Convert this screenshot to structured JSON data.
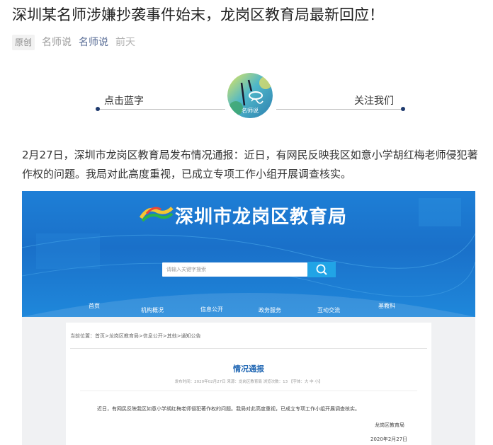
{
  "article": {
    "title": "深圳某名师涉嫌抄袭事件始末，龙岗区教育局最新回应！",
    "badge": "原创",
    "author": "名师说",
    "account": "名师说",
    "time": "前天"
  },
  "follow": {
    "left_label": "点击蓝字",
    "right_label": "关注我们",
    "logo_text": "名师说"
  },
  "body": {
    "paragraph": "2月27日，深圳市龙岗区教育局发布情况通报：近日，有网民反映我区如意小学胡红梅老师侵犯著作权的问题。我局对此高度重视，已成立专项工作小组开展调查核实。"
  },
  "embedded": {
    "site_name": "深圳市龙岗区教育局",
    "search_placeholder": "请输入关键字搜索",
    "nav": [
      "首页",
      "机构概况",
      "信息公开",
      "政务服务",
      "互动交流",
      "基教科"
    ],
    "breadcrumb": "当前位置：首页>龙岗区教育局>信息公开>其他>通知公告",
    "doc_title": "情况通报",
    "doc_meta": "发布时间：2020年02月27日    来源：龙岗区教育局    浏览次数：13    【字体：大 中 小】",
    "doc_body": "近日，有网民反映我区如意小学胡红梅老师侵犯著作权的问题。我局对此高度重视，已成立专项工作小组开展调查核实。",
    "doc_org": "龙岗区教育局",
    "doc_date": "2020年2月27日"
  },
  "colors": {
    "account_link": "#576b95",
    "banner_blue": "#1a70c9",
    "doc_title": "#1f66b3",
    "dot": "#1e3a6e"
  }
}
